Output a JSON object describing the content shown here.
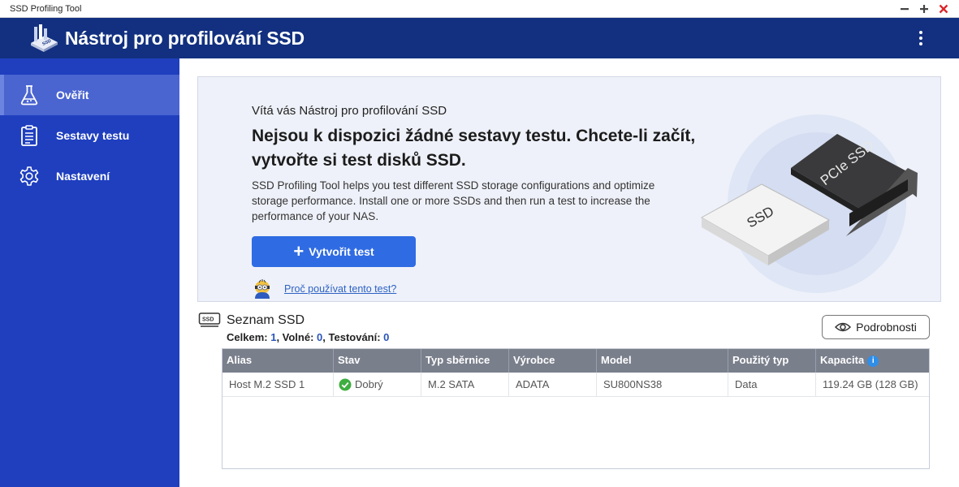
{
  "window": {
    "title": "SSD Profiling Tool"
  },
  "header": {
    "app_title": "Nástroj pro profilování SSD",
    "brand_color": "#12307f"
  },
  "sidebar": {
    "items": [
      {
        "label": "Ověřit",
        "icon": "flask-icon",
        "active": true
      },
      {
        "label": "Sestavy testu",
        "icon": "clipboard-list-icon",
        "active": false
      },
      {
        "label": "Nastavení",
        "icon": "gear-icon",
        "active": false
      }
    ]
  },
  "welcome": {
    "greeting": "Vítá vás Nástroj pro profilování SSD",
    "headline": "Nejsou k dispozici žádné sestavy testu. Chcete-li začít, vytvořte si test disků SSD.",
    "description": "SSD Profiling Tool helps you test different SSD storage configurations and optimize storage performance. Install one or more SSDs and then run a test to increase the performance of your NAS.",
    "create_button": "Vytvořit test",
    "why_link": "Proč používat tento test?",
    "illustration_labels": {
      "ssd": "SSD",
      "pcie": "PCIe SSD"
    }
  },
  "ssd_list": {
    "title": "Seznam SSD",
    "counts": {
      "total_label": "Celkem: ",
      "total": "1",
      "free_label": ", Volné: ",
      "free": "0",
      "testing_label": ", Testování: ",
      "testing": "0"
    },
    "details_button": "Podrobnosti",
    "columns": [
      "Alias",
      "Stav",
      "Typ sběrnice",
      "Výrobce",
      "Model",
      "Použitý typ",
      "Kapacita"
    ],
    "rows": [
      {
        "alias": "Host M.2 SSD 1",
        "status": "Dobrý",
        "bus": "M.2 SATA",
        "vendor": "ADATA",
        "model": "SU800NS38",
        "used_type": "Data",
        "capacity": "119.24 GB (128 GB)"
      }
    ]
  }
}
